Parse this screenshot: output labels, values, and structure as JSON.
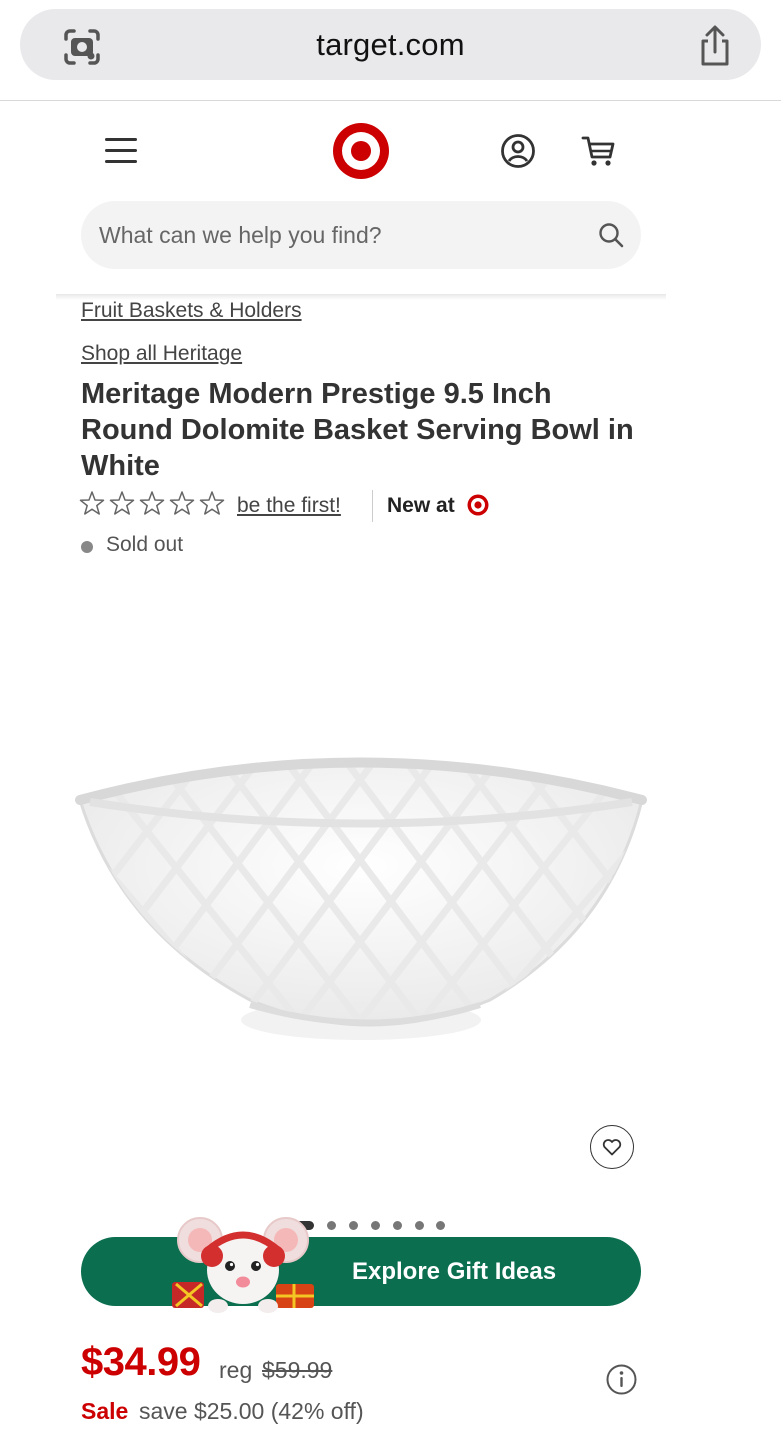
{
  "browser": {
    "url": "target.com"
  },
  "search": {
    "placeholder": "What can we help you find?"
  },
  "product": {
    "breadcrumb": "Fruit Baskets & Holders",
    "brand_link": "Shop all Heritage",
    "title": "Meritage Modern Prestige 9.5 Inch Round Dolomite Basket Serving Bowl in White",
    "rating": {
      "stars_filled": 0,
      "stars_total": 5,
      "review_link": "be the first!"
    },
    "new_at_label": "New at",
    "availability": "Sold out",
    "image_count": 8,
    "active_image": 1
  },
  "promo": {
    "banner_label": "Explore Gift Ideas"
  },
  "pricing": {
    "current_price": "$34.99",
    "reg_label": "reg",
    "reg_price": "$59.99",
    "sale_label": "Sale",
    "savings_text": "save $25.00 (42% off)"
  },
  "colors": {
    "brand_red": "#cc0000",
    "banner_green": "#0b6e4f",
    "text_dark": "#333333",
    "text_muted": "#555555"
  },
  "icons": [
    "camera-lens-icon",
    "share-icon",
    "hamburger-menu-icon",
    "target-logo",
    "account-icon",
    "cart-icon",
    "search-icon",
    "star-icon",
    "heart-icon",
    "info-icon"
  ]
}
